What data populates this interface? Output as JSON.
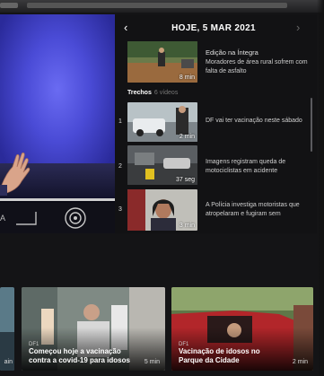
{
  "header": {
    "date": "HOJE, 5 MAR 2021",
    "prev_icon": "chevron-left-icon",
    "next_icon": "chevron-right-icon"
  },
  "featured": {
    "title": "Edição na Íntegra",
    "description": "Moradores de área rural sofrem com falta de asfalto",
    "duration": "8 min"
  },
  "section": {
    "title": "Trechos",
    "count": "6 vídeos"
  },
  "clips": [
    {
      "number": "1",
      "description": "DF vai ter vacinação neste sábado",
      "duration": "2 min"
    },
    {
      "number": "2",
      "description": "Imagens registram queda de motociclistas em acidente",
      "duration": "37 seg"
    },
    {
      "number": "3",
      "description": "A Polícia investiga motoristas que atropelaram e fugiram sem",
      "duration": "3 min"
    }
  ],
  "row_cards": [
    {
      "label": "DF1",
      "title": "Começou hoje a vacinação contra a covid-19 para idosos",
      "duration": "5 min"
    },
    {
      "label": "DF1",
      "title": "Vacinação de idosos no Parque da Cidade",
      "duration": "2 min"
    }
  ],
  "partial_left": {
    "duration": "ain"
  },
  "colors": {
    "accent": "#ffffff",
    "panel": "#121214",
    "background": "#141416"
  }
}
